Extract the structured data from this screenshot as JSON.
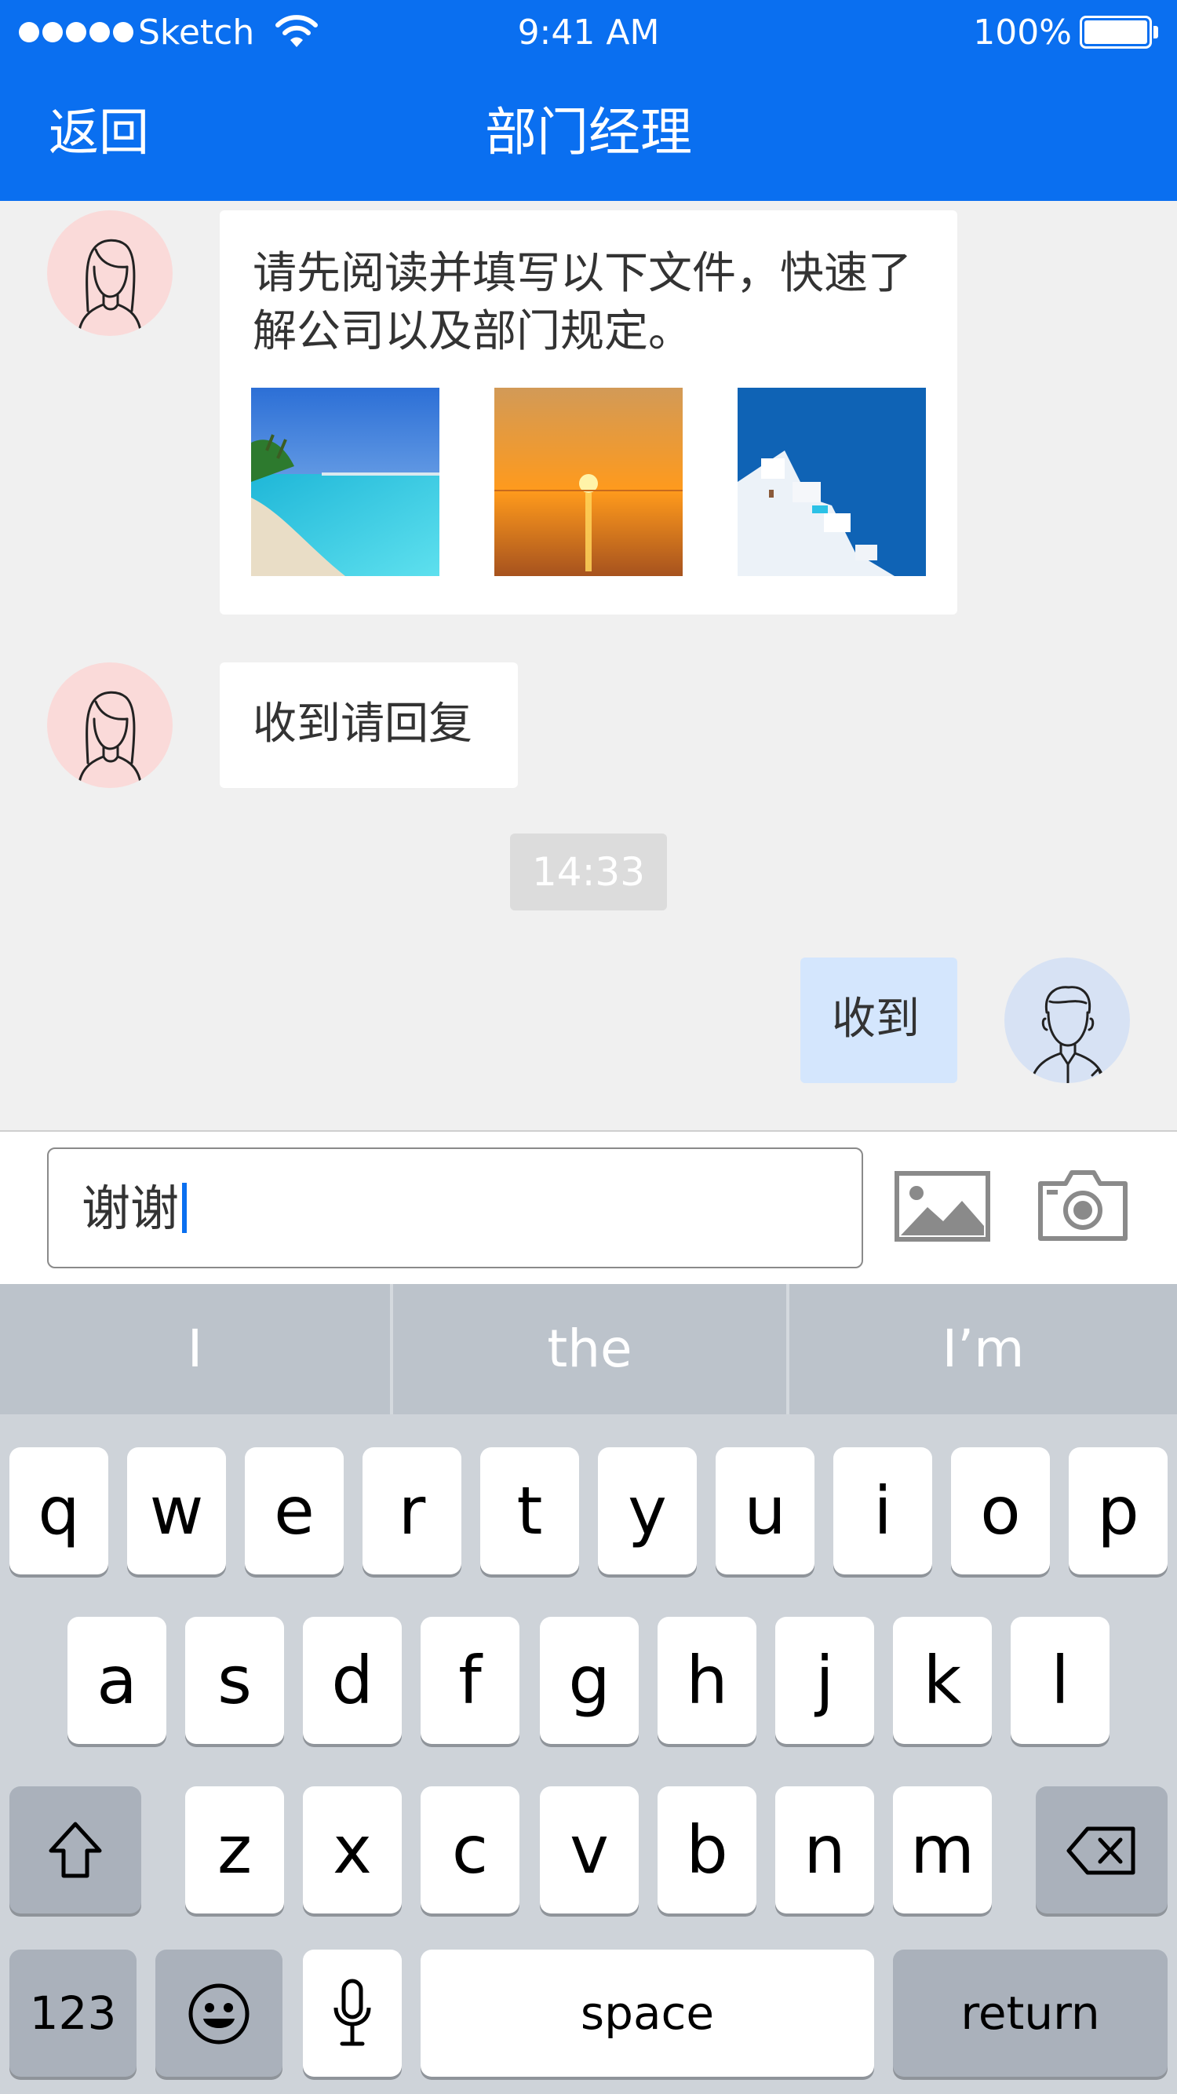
{
  "status_bar": {
    "carrier": "Sketch",
    "time": "9:41 AM",
    "battery": "100%",
    "signal_icon": "signal-dots-icon",
    "wifi_icon": "wifi-icon",
    "battery_icon": "battery-icon"
  },
  "nav": {
    "back": "返回",
    "title": "部门经理"
  },
  "messages": [
    {
      "sender": "other",
      "text": "请先阅读并填写以下文件，快速了解公司以及部门规定。",
      "images": [
        "beach-photo",
        "sunset-photo",
        "santorini-photo"
      ]
    },
    {
      "sender": "other",
      "text": "收到请回复"
    },
    {
      "sender": "me",
      "text": "收到"
    }
  ],
  "timestamp": "14:33",
  "input": {
    "value": "谢谢",
    "image_icon": "image-icon",
    "camera_icon": "camera-icon"
  },
  "keyboard": {
    "suggestions": [
      "I",
      "the",
      "I’m"
    ],
    "row1": [
      "q",
      "w",
      "e",
      "r",
      "t",
      "y",
      "u",
      "i",
      "o",
      "p"
    ],
    "row2": [
      "a",
      "s",
      "d",
      "f",
      "g",
      "h",
      "j",
      "k",
      "l"
    ],
    "row3": [
      "z",
      "x",
      "c",
      "v",
      "b",
      "n",
      "m"
    ],
    "numbers_key": "123",
    "space_key": "space",
    "return_key": "return",
    "shift_icon": "shift-icon",
    "delete_icon": "delete-icon",
    "emoji_icon": "emoji-icon",
    "mic_icon": "microphone-icon"
  },
  "colors": {
    "accent": "#0a6ff0",
    "chat_background": "#f0f0f0",
    "my_bubble": "#d4e6fd",
    "other_avatar_bg": "#fadad9",
    "my_avatar_bg": "#d7e2f4"
  }
}
